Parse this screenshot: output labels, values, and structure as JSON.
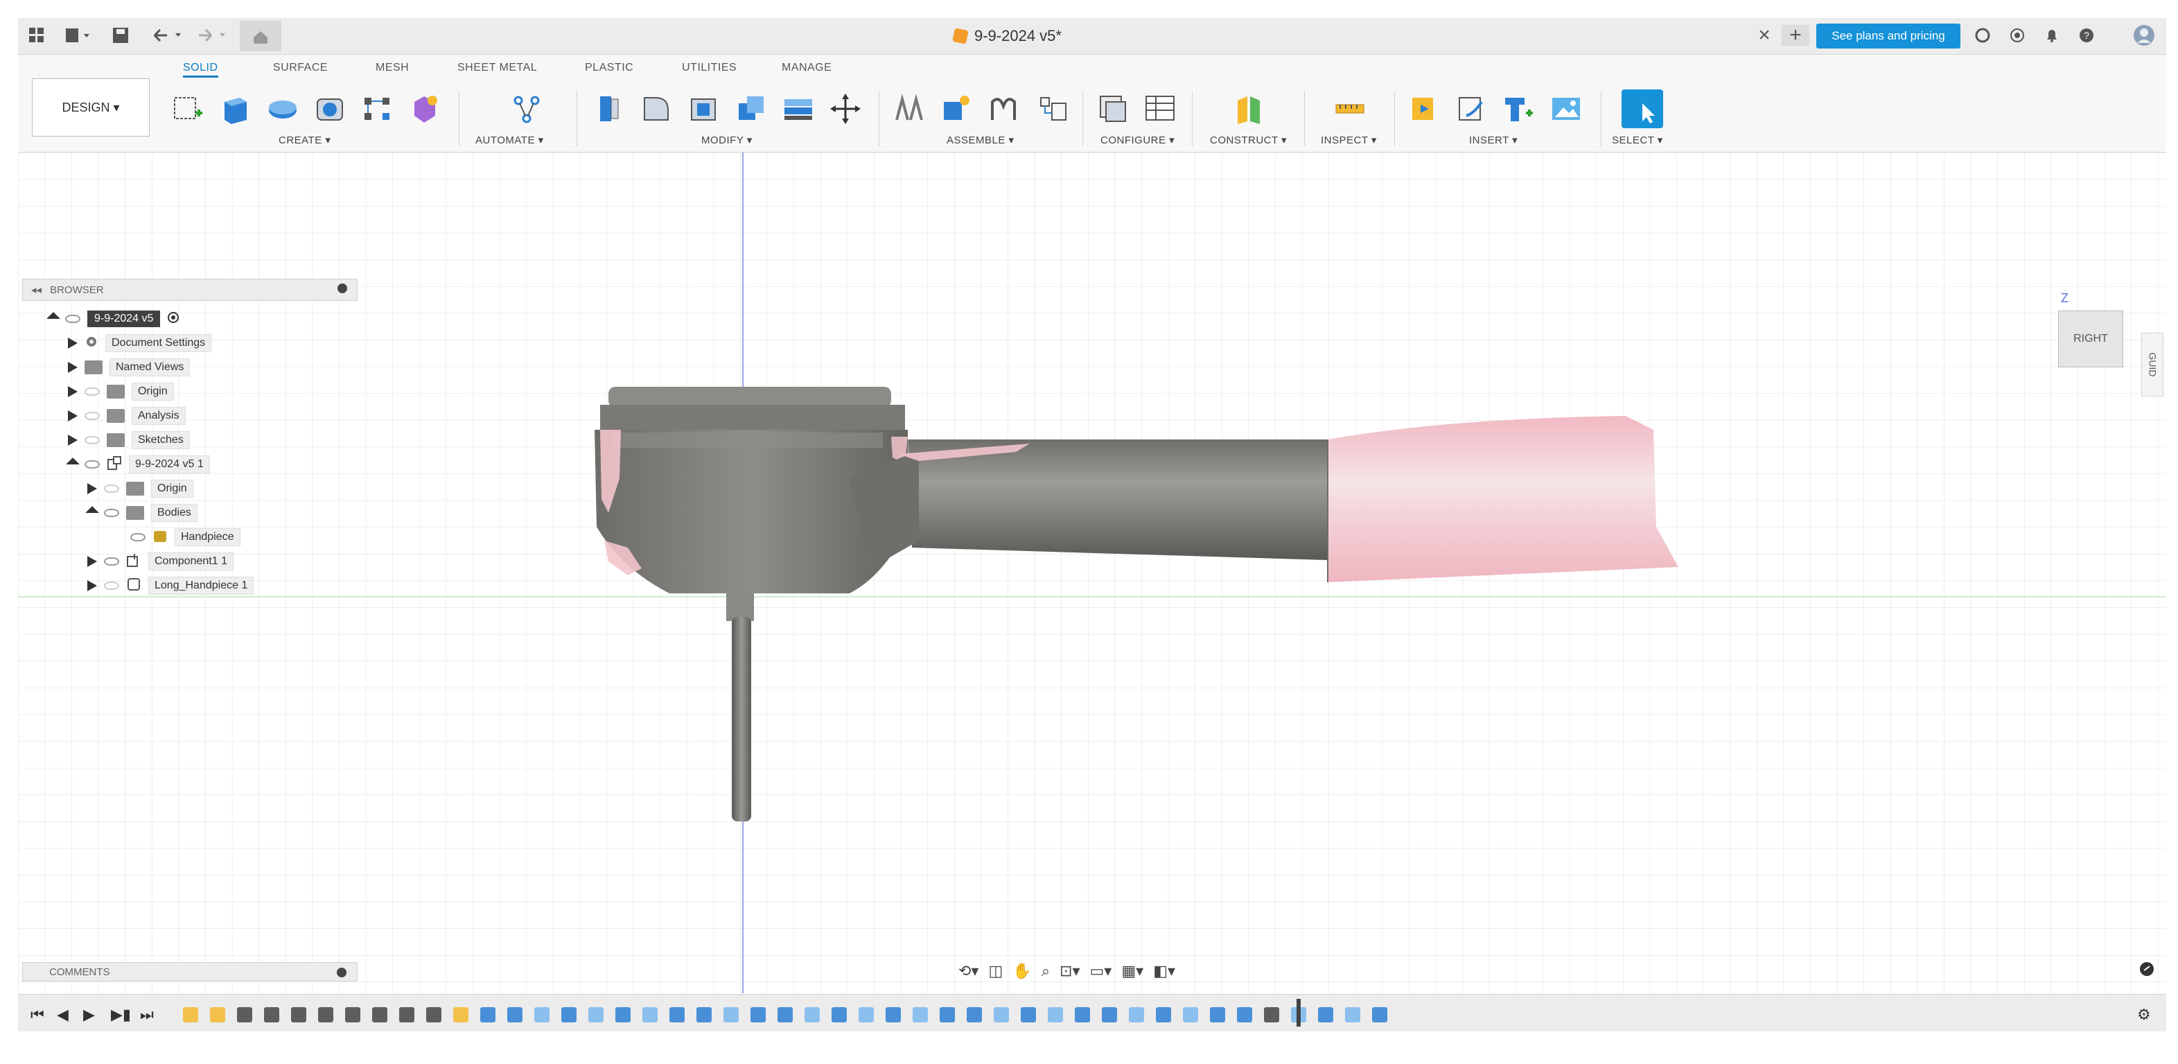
{
  "title_bar": {
    "document_title": "9-9-2024 v5*",
    "trial_button": "See plans and pricing"
  },
  "ribbon": {
    "workspace_button": "DESIGN ▾",
    "tabs": [
      "SOLID",
      "SURFACE",
      "MESH",
      "SHEET METAL",
      "PLASTIC",
      "UTILITIES",
      "MANAGE"
    ],
    "active_tab": "SOLID",
    "groups": [
      "CREATE ▾",
      "AUTOMATE ▾",
      "MODIFY ▾",
      "ASSEMBLE ▾",
      "CONFIGURE ▾",
      "CONSTRUCT ▾",
      "INSPECT ▾",
      "INSERT ▾",
      "SELECT ▾"
    ]
  },
  "browser": {
    "header": "BROWSER",
    "root": "9-9-2024 v5",
    "items": [
      {
        "label": "Document Settings"
      },
      {
        "label": "Named Views"
      },
      {
        "label": "Origin"
      },
      {
        "label": "Analysis"
      },
      {
        "label": "Sketches"
      },
      {
        "label": "9-9-2024 v5 1"
      },
      {
        "label": "Origin"
      },
      {
        "label": "Bodies"
      },
      {
        "label": "Handpiece"
      },
      {
        "label": "Component1 1"
      },
      {
        "label": "Long_Handpiece 1"
      }
    ]
  },
  "comments": {
    "label": "COMMENTS"
  },
  "viewcube": {
    "face": "RIGHT",
    "axis": "Z"
  },
  "side_tab": {
    "label": "GUID"
  },
  "colors": {
    "accent": "#0b7bc4",
    "trial_button": "#1592d8",
    "model_gray": "#7d7c78",
    "model_pink": "#f2c4cb",
    "grid_line": "#d9d9d9"
  }
}
